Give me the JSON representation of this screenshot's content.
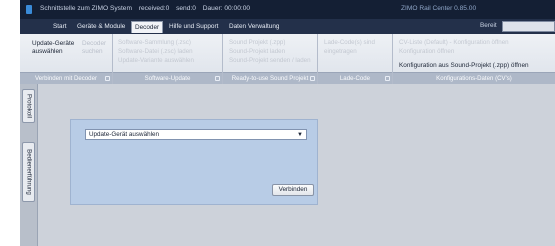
{
  "titlebar": {
    "interface_label": "Schnittstelle zum ZIMO System",
    "received": "received:0",
    "send": "send:0",
    "duration": "Dauer: 00:00:00",
    "app_title": "ZIMO Rail Center 0.85.00"
  },
  "menu": {
    "tabs": [
      "Start",
      "Geräte & Module",
      "Decoder",
      "Hilfe und Support",
      "Daten Verwaltung"
    ],
    "active_tab": "Decoder",
    "ready_label": "Bereit"
  },
  "ribbon": {
    "group_connect": {
      "select_device_line1": "Update-Geräte",
      "select_device_line2": "auswählen",
      "search_line1": "Decoder",
      "search_line2": "suchen",
      "footer": "Verbinden mit Decoder"
    },
    "group_software_update": {
      "line1": "Software-Sammlung (.zsc)",
      "line2": "Software-Datei (.zsc) laden",
      "line3": "Update-Variante auswählen",
      "footer": "Software-Update"
    },
    "group_sound": {
      "line1": "Sound Projekt (.zpp)",
      "line2": "Sound-Projekt laden",
      "line3": "Sound-Projekt senden / laden",
      "footer": "Ready-to-use Sound Projekt"
    },
    "group_load_code": {
      "line1": "Lade-Code(s) sind",
      "line2": "eingetragen",
      "footer": "Lade-Code"
    },
    "group_config": {
      "line1": "CV-Liste (Default) - Konfiguration öffnen",
      "line2": "Konfiguration öffnen",
      "open_from_sound": "Konfiguration aus Sound-Projekt (.zpp) öffnen",
      "footer": "Konfigurations-Daten (CV's)"
    }
  },
  "sidebar": {
    "tabs": [
      "Protokoll",
      "Bedienerführung"
    ]
  },
  "main": {
    "device_select_value": "Update-Gerät auswählen",
    "connect_label": "Verbinden"
  }
}
